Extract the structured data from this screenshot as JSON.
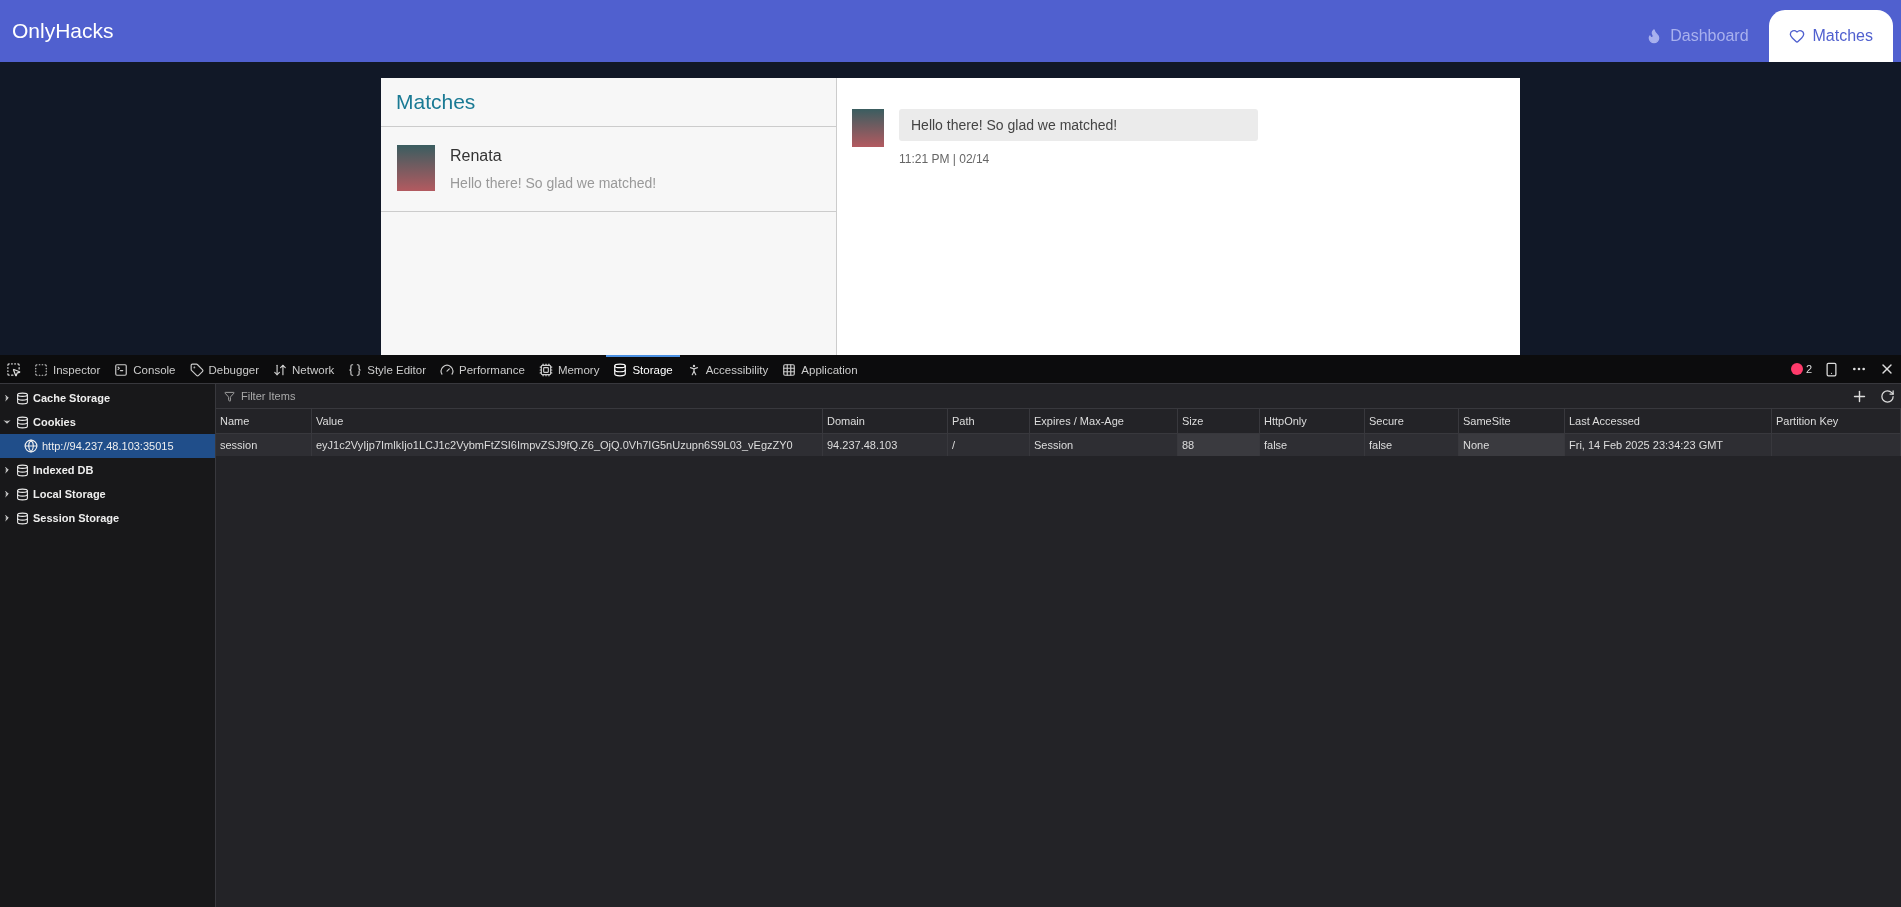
{
  "header": {
    "brand": "OnlyHacks",
    "nav": [
      {
        "label": "Dashboard",
        "selected": false
      },
      {
        "label": "Matches",
        "selected": true
      }
    ]
  },
  "matches": {
    "title": "Matches",
    "items": [
      {
        "name": "Renata",
        "preview": "Hello there! So glad we matched!",
        "selected": false
      }
    ]
  },
  "chat": {
    "messages": [
      {
        "text": "Hello there! So glad we matched!",
        "time": "11:21 PM | 02/14"
      }
    ]
  },
  "devtools": {
    "tabs": [
      {
        "label": "Inspector",
        "selected": false
      },
      {
        "label": "Console",
        "selected": false
      },
      {
        "label": "Debugger",
        "selected": false
      },
      {
        "label": "Network",
        "selected": false
      },
      {
        "label": "Style Editor",
        "selected": false
      },
      {
        "label": "Performance",
        "selected": false
      },
      {
        "label": "Memory",
        "selected": false
      },
      {
        "label": "Storage",
        "selected": true
      },
      {
        "label": "Accessibility",
        "selected": false
      },
      {
        "label": "Application",
        "selected": false
      }
    ],
    "error_count": "2",
    "tree": [
      {
        "label": "Cache Storage",
        "expanded": false,
        "selected": false
      },
      {
        "label": "Cookies",
        "expanded": true,
        "selected": false,
        "children": [
          {
            "label": "http://94.237.48.103:35015",
            "selected": true
          }
        ]
      },
      {
        "label": "Indexed DB",
        "expanded": false,
        "selected": false
      },
      {
        "label": "Local Storage",
        "expanded": false,
        "selected": false
      },
      {
        "label": "Session Storage",
        "expanded": false,
        "selected": false
      }
    ],
    "filter_placeholder": "Filter Items",
    "table": {
      "columns": [
        "Name",
        "Value",
        "Domain",
        "Path",
        "Expires / Max-Age",
        "Size",
        "HttpOnly",
        "Secure",
        "SameSite",
        "Last Accessed",
        "Partition Key"
      ],
      "rows": [
        [
          "session",
          "eyJ1c2VyIjp7ImlkIjo1LCJ1c2VybmFtZSI6ImpvZSJ9fQ.Z6_OjQ.0Vh7IG5nUzupn6S9L03_vEgzZY0",
          "94.237.48.103",
          "/",
          "Session",
          "88",
          "false",
          "false",
          "None",
          "Fri, 14 Feb 2025 23:34:23 GMT",
          ""
        ]
      ]
    }
  }
}
